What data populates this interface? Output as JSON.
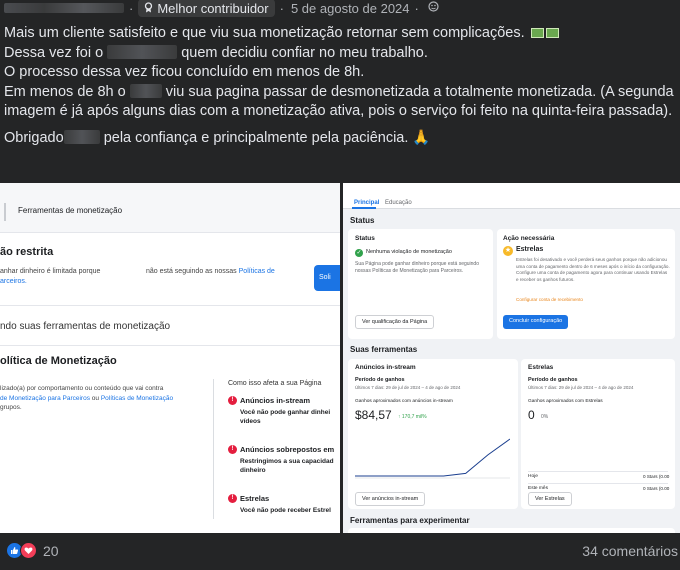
{
  "header": {
    "dot": "·",
    "badge_label": "Melhor contribuidor",
    "date": "5 de agosto de 2024",
    "separator": "·"
  },
  "post": {
    "line1": "Mais um cliente satisfeito e que viu sua monetização retornar sem complicações.",
    "line2_a": "Dessa vez foi o",
    "line2_b": "quem decidiu confiar no meu trabalho.",
    "line3": "O processo dessa vez ficou concluído em menos de 8h.",
    "line4_a": "Em menos de 8h o",
    "line4_b": "viu sua pagina passar de desmonetizada a totalmente monetizada. (A segunda imagem é já após alguns dias com a monetização ativa, pois o serviço foi feito na quinta-feira passada).",
    "line5_a": "Obrigado",
    "line5_b": "pela confiança e principalmente pela paciência.",
    "pray_emoji": "🙏"
  },
  "left_shot": {
    "tab": "Ferramentas de monetização",
    "heading": "ão restrita",
    "desc1": "anhar dinheiro é limitada porque",
    "desc1b": "arceiros.",
    "desc2": "não está seguindo as nossas",
    "desc2_link": "Políticas de",
    "button": "Soli",
    "section2": "ndo suas ferramentas de monetização",
    "policy_title": "olítica de Monetização",
    "policy_text_a": "lizado(a) por comportamento ou conteúdo que vai contra",
    "policy_link1": "de Monetização para Parceiros",
    "policy_or": "ou",
    "policy_link2": "Políticas de Monetização",
    "policy_text_b": "grupos.",
    "side_title": "Como isso afeta a sua Página",
    "items": [
      {
        "title": "Anúncios in-stream",
        "desc": "Você não pode ganhar dinhei vídeos"
      },
      {
        "title": "Anúncios sobrepostos em",
        "desc": "Restringimos a sua capacidad dinheiro"
      },
      {
        "title": "Estrelas",
        "desc": "Você não pode receber Estrel"
      }
    ]
  },
  "right_shot": {
    "tab_main": "Principal",
    "tab_edu": "Educação",
    "status_heading": "Status",
    "status_card": {
      "title": "Status",
      "check_text": "Nenhuma violação de monetização",
      "desc": "Sua Página pode ganhar dinheiro porque está seguindo nossas Políticas de Monetização para Parceiros.",
      "button": "Ver qualificação da Página"
    },
    "action_card": {
      "title": "Ação necessária",
      "item_title": "Estrelas",
      "desc": "Estrelas foi desativado e você perderá seus ganhos porque não adicionou uma conta de pagamento dentro de 6 meses após o início da configuração. Configure uma conta de pagamento agora para continuar usando Estrelas e receber os ganhos futuros.",
      "link": "Configurar conta de recebimento",
      "button": "Concluir configuração"
    },
    "tools_heading": "Suas ferramentas",
    "instream": {
      "title": "Anúncios in-stream",
      "period_label": "Período de ganhos",
      "period": "Últimos 7 dias: 29 de jul de 2024 – 4 de ago de 2024",
      "earn_label": "Ganhos aproximados com anúncios in-stream",
      "amount": "$84,57",
      "change": "↑ 170,7 mil%",
      "button": "Ver anúncios in-stream",
      "chart_data": {
        "type": "line",
        "values": [
          0,
          0,
          0,
          0,
          0,
          1,
          8,
          14
        ],
        "title": "",
        "xlabel": "",
        "ylabel": ""
      }
    },
    "stars": {
      "title": "Estrelas",
      "period_label": "Período de ganhos",
      "period": "Últimos 7 dias: 29 de jul de 2024 – 4 de ago de 2024",
      "earn_label": "Ganhos aproximados com Estrelas",
      "amount": "0",
      "change": "0%",
      "row1_label": "Hoje",
      "row1_value": "0 Stars (0.00",
      "row2_label": "Este mês",
      "row2_value": "0 Stars (0.00",
      "button": "Ver Estrelas"
    },
    "experiment_heading": "Ferramentas para experimentar"
  },
  "footer": {
    "reaction_count": "20",
    "comments": "34 comentários"
  }
}
